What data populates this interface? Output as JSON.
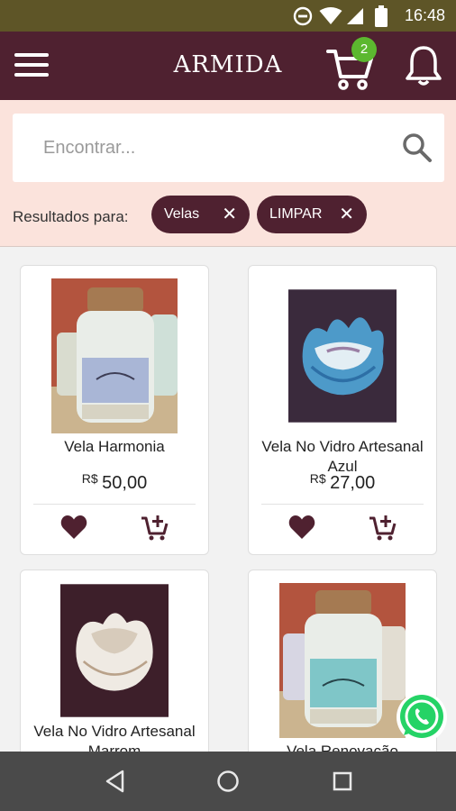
{
  "status_bar": {
    "time": "16:48",
    "icons": [
      "do-not-disturb-icon",
      "wifi-icon",
      "signal-icon",
      "battery-icon"
    ]
  },
  "app_bar": {
    "brand": "ARMIDA",
    "cart_count": "2",
    "icons": [
      "menu-icon",
      "cart-icon",
      "bell-icon"
    ]
  },
  "search": {
    "placeholder": "Encontrar...",
    "value": "",
    "icon": "search-icon"
  },
  "filters": {
    "label": "Resultados para:",
    "chips": [
      {
        "label": "Velas"
      },
      {
        "label": "LIMPAR"
      }
    ]
  },
  "products": [
    {
      "name": "Vela Harmonia",
      "currency": "R$",
      "price": "50,00"
    },
    {
      "name": "Vela No Vidro Artesanal Azul",
      "currency": "R$",
      "price": "27,00"
    },
    {
      "name": "Vela No Vidro Artesanal Marrom",
      "currency": "",
      "price": ""
    },
    {
      "name": "Vela Renovação",
      "currency": "",
      "price": ""
    }
  ],
  "colors": {
    "status_bar": "#5e5527",
    "app_bar": "#4f2130",
    "accent": "#4f2130",
    "badge": "#5cb82f",
    "search_zone": "#fbe3dc",
    "whatsapp": "#25d366"
  },
  "system_nav": [
    "back-icon",
    "home-icon",
    "recents-icon"
  ]
}
